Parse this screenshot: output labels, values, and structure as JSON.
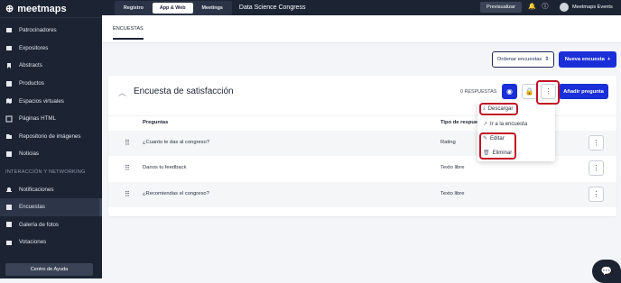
{
  "brand": {
    "name": "meetmaps"
  },
  "sidebar": {
    "items": [
      {
        "label": "Patrocinadores",
        "icon": "flag-icon"
      },
      {
        "label": "Expositores",
        "icon": "store-icon"
      },
      {
        "label": "Abstracts",
        "icon": "bookmark-icon"
      },
      {
        "label": "Productos",
        "icon": "box-icon"
      },
      {
        "label": "Espacios virtuales",
        "icon": "map-icon"
      },
      {
        "label": "Páginas HTML",
        "icon": "code-icon"
      },
      {
        "label": "Repositorio de imágenes",
        "icon": "folder-icon"
      },
      {
        "label": "Noticias",
        "icon": "news-icon"
      }
    ],
    "section": "INTERACCIÓN Y NETWORKING",
    "items2": [
      {
        "label": "Notificaciones",
        "icon": "bell-icon"
      },
      {
        "label": "Encuestas",
        "icon": "list-icon",
        "active": true
      },
      {
        "label": "Galería de fotos",
        "icon": "image-icon"
      },
      {
        "label": "Votaciones",
        "icon": "vote-icon"
      }
    ],
    "help": "Centro de Ayuda"
  },
  "topbar": {
    "tabs": [
      "Registro",
      "App & Web",
      "Meetings"
    ],
    "active_tab": "App & Web",
    "event_title": "Data Science Congress",
    "preview": "Previsualizar",
    "user": "Meetmaps Events"
  },
  "subtabs": {
    "active": "ENCUESTAS"
  },
  "actions": {
    "order": "Ordenar encuestas",
    "new": "Nueva encuesta"
  },
  "survey": {
    "title": "Encuesta de satisfacción",
    "responses": "0 RESPUESTAS",
    "add_question": "Añadir pregunta",
    "columns": [
      "Preguntas",
      "Tipo de respuesta"
    ],
    "rows": [
      {
        "q": "¿Cuanto le das al congreso?",
        "t": "Rating"
      },
      {
        "q": "Danos tu feedback",
        "t": "Texto libre"
      },
      {
        "q": "¿Recomiendas el congreso?",
        "t": "Texto libre"
      }
    ]
  },
  "menu": {
    "items": [
      "Descargar",
      "Ir a la encuesta",
      "Editar",
      "Eliminar"
    ]
  },
  "colors": {
    "primary": "#1a2fd8",
    "sidebar": "#1c2434",
    "highlight": "#c01226"
  }
}
